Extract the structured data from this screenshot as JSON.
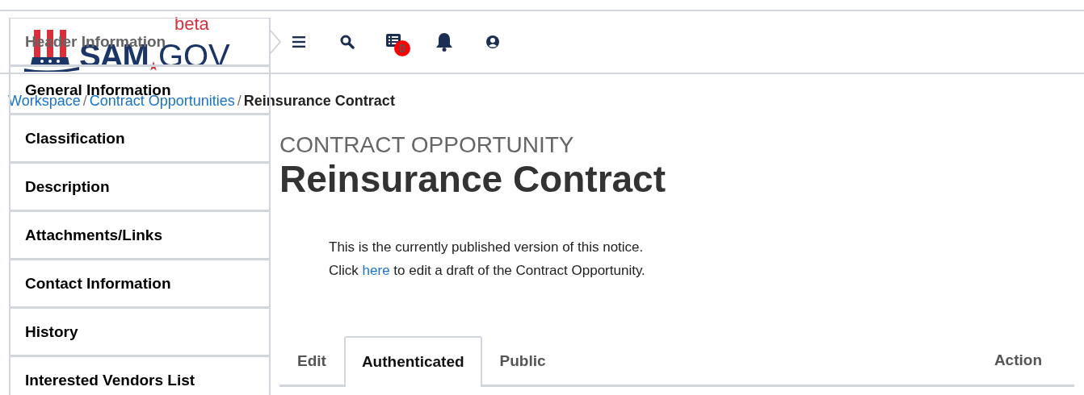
{
  "logo": {
    "name": "SAM",
    "suffix": "GOV",
    "badge": "beta"
  },
  "header_badge": "0",
  "sidebar": {
    "items": [
      {
        "label": "Header Information",
        "selected": true
      },
      {
        "label": "General Information",
        "selected": false
      },
      {
        "label": "Classification",
        "selected": false
      },
      {
        "label": "Description",
        "selected": false
      },
      {
        "label": "Attachments/Links",
        "selected": false
      },
      {
        "label": "Contact Information",
        "selected": false
      },
      {
        "label": "History",
        "selected": false
      },
      {
        "label": "Interested Vendors List",
        "selected": false
      }
    ]
  },
  "breadcrumb": {
    "links": [
      "Workspace",
      "Contract Opportunities"
    ],
    "separator": "/",
    "current": "Reinsurance Contract"
  },
  "eyebrow": "CONTRACT OPPORTUNITY",
  "title": "Reinsurance Contract",
  "notice": {
    "line1": "This is the currently published version of this notice.",
    "before": "Click",
    "link": "here",
    "after": "to edit a draft of the Contract Opportunity."
  },
  "tabs": [
    {
      "label": "Edit",
      "selected": false
    },
    {
      "label": "Authenticated",
      "selected": true
    },
    {
      "label": "Public",
      "selected": false
    }
  ],
  "action": "Action"
}
